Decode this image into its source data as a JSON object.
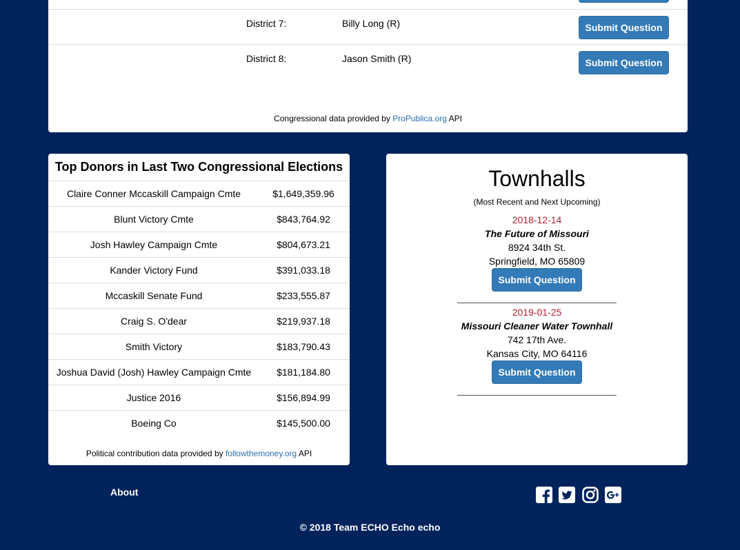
{
  "congress": {
    "representatives": [
      {
        "district": "District 7:",
        "name": "Billy Long (R)",
        "button": "Submit Question"
      },
      {
        "district": "District 8:",
        "name": "Jason Smith (R)",
        "button": "Submit Question"
      }
    ],
    "credit_prefix": "Congressional data provided by",
    "credit_link": "ProPublica.org",
    "credit_suffix": "API"
  },
  "donors": {
    "title": "Top Donors in Last Two Congressional Elections",
    "rows": [
      {
        "name": "Claire Conner Mccaskill Campaign Cmte",
        "amount": "$1,649,359.96"
      },
      {
        "name": "Blunt Victory Cmte",
        "amount": "$843,764.92"
      },
      {
        "name": "Josh Hawley Campaign Cmte",
        "amount": "$804,673.21"
      },
      {
        "name": "Kander Victory Fund",
        "amount": "$391,033.18"
      },
      {
        "name": "Mccaskill Senate Fund",
        "amount": "$233,555.87"
      },
      {
        "name": "Craig S. O'dear",
        "amount": "$219,937.18"
      },
      {
        "name": "Smith Victory",
        "amount": "$183,790.43"
      },
      {
        "name": "Joshua David (Josh) Hawley Campaign Cmte",
        "amount": "$181,184.80"
      },
      {
        "name": "Justice 2016",
        "amount": "$156,894.99"
      },
      {
        "name": "Boeing Co",
        "amount": "$145,500.00"
      }
    ],
    "credit_prefix": "Political contribution data provided by",
    "credit_link": "followthemoney.org",
    "credit_suffix": "API"
  },
  "townhalls": {
    "title": "Townhalls",
    "subtitle": "(Most Recent and Next Upcoming)",
    "events": [
      {
        "date": "2018-12-14",
        "name": "The Future of Missouri",
        "street": "8924 34th St.",
        "city": "Springfield, MO 65809",
        "button": "Submit Question"
      },
      {
        "date": "2019-01-25",
        "name": "Missouri Cleaner Water Townhall",
        "street": "742 17th Ave.",
        "city": "Kansas City, MO 64116",
        "button": "Submit Question"
      }
    ]
  },
  "footer": {
    "about": "About",
    "social_icons": [
      "facebook-icon",
      "twitter-icon",
      "instagram-icon",
      "google-plus-icon"
    ],
    "copyright": "© 2018 Team ECHO Echo echo"
  },
  "colors": {
    "background": "#00235b",
    "button": "#337ab7",
    "link": "#2a6cb0",
    "date": "#b3202f"
  }
}
